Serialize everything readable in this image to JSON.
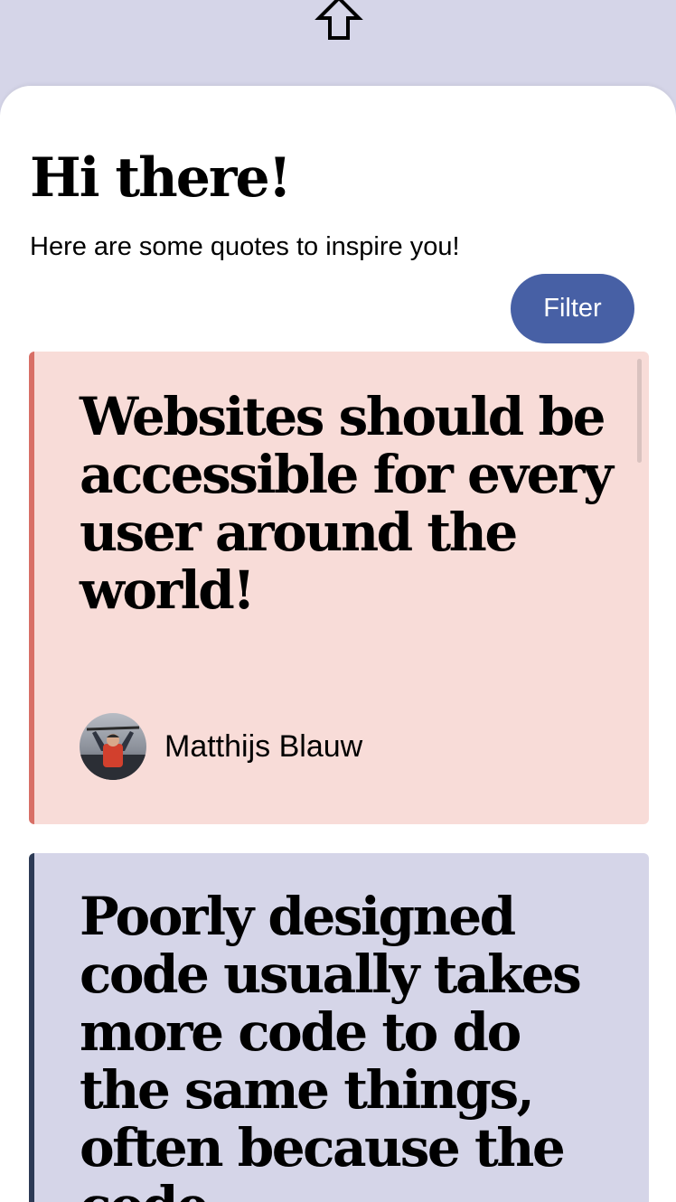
{
  "icons": {
    "top": "up-arrow-icon"
  },
  "header": {
    "greeting": "Hi there!",
    "subtitle": "Here are some quotes to inspire you!"
  },
  "filter": {
    "label": "Filter"
  },
  "quotes": [
    {
      "text": "Websites should be accessible for every user around the world!",
      "author": "Matthijs Blauw",
      "color": "#f8dcd8",
      "accent": "#d86f66"
    },
    {
      "text": "Poorly designed code usually takes more code to do the same things, often because the code",
      "color": "#d5d5e8",
      "accent": "#2c3a55"
    }
  ],
  "colors": {
    "background": "#d5d5e8",
    "button": "#4760a5",
    "sheet": "#ffffff"
  }
}
